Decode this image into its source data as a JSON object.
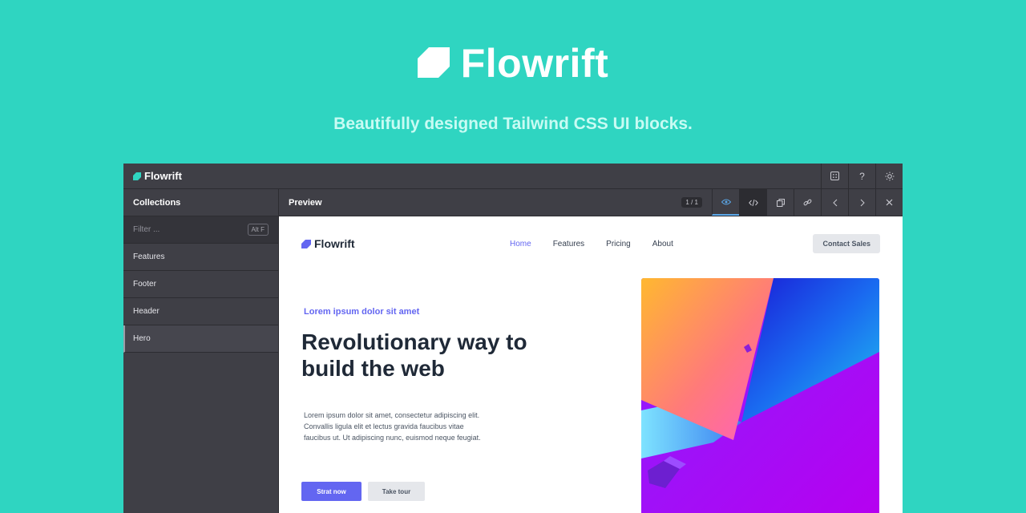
{
  "hero": {
    "brand": "Flowrift",
    "tagline": "Beautifully designed Tailwind CSS UI blocks."
  },
  "app": {
    "brand": "Flowrift",
    "topbar_icons": [
      "grid-icon",
      "help-icon",
      "sun-icon"
    ],
    "help_glyph": "?",
    "sidebar": {
      "title": "Collections",
      "filter_placeholder": "Filter ...",
      "filter_shortcut": "Alt F",
      "items": [
        {
          "label": "Features",
          "active": false
        },
        {
          "label": "Footer",
          "active": false
        },
        {
          "label": "Header",
          "active": false
        },
        {
          "label": "Hero",
          "active": true
        }
      ]
    },
    "preview": {
      "title": "Preview",
      "page_indicator": "1 / 1",
      "tools": [
        "eye-icon",
        "code-icon",
        "copy-icon",
        "link-icon",
        "chevron-left-icon",
        "chevron-right-icon",
        "close-icon"
      ]
    }
  },
  "site": {
    "brand": "Flowrift",
    "nav": [
      "Home",
      "Features",
      "Pricing",
      "About"
    ],
    "active_nav": "Home",
    "contact": "Contact Sales",
    "eyebrow": "Lorem ipsum dolor sit amet",
    "headline": "Revolutionary way to build the web",
    "body": "Lorem ipsum dolor sit amet, consectetur adipiscing elit. Convallis ligula elit et lectus gravida faucibus vitae faucibus ut. Ut adipiscing nunc, euismod neque feugiat.",
    "primary_cta": "Strat now",
    "secondary_cta": "Take tour"
  },
  "colors": {
    "background": "#2fd5c1",
    "accent": "#6366f1",
    "panel": "#3f3f46"
  }
}
